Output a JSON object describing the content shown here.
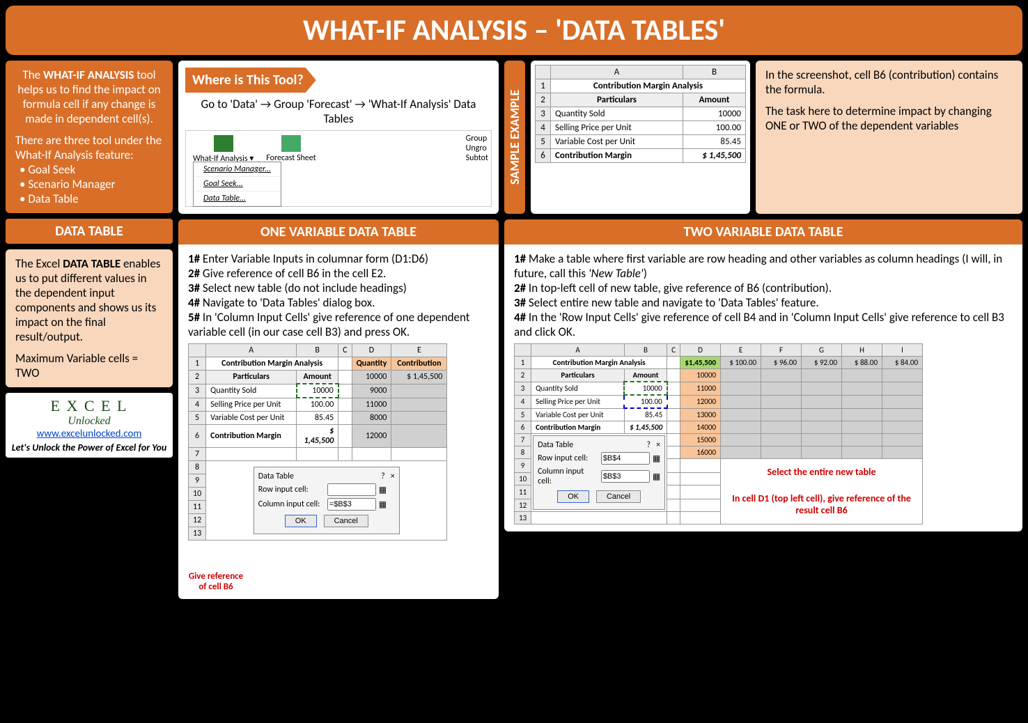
{
  "title": "WHAT-IF ANALYSIS – 'DATA TABLES'",
  "sidebar": {
    "intro_html": "The <b>WHAT-IF ANALYSIS</b> tool helps us to find the impact on formula cell if any change is made in dependent cell(s).",
    "three_tools_lead": "There are three tool under the What-If Analysis feature:",
    "tools": [
      "Goal Seek",
      "Scenario Manager",
      "Data Table"
    ],
    "datatable_header": "DATA TABLE",
    "datatable_body_html": "The Excel <b>DATA TABLE</b> enables us to put different values in the dependent input components and shows us its impact on the final result/output.",
    "max_var": "Maximum Variable cells = TWO",
    "logo_top": "E X C E L",
    "logo_sub": "Unlocked",
    "url": "www.excelunlocked.com",
    "tagline": "Let's Unlock the Power of Excel for You"
  },
  "where": {
    "label": "Where is This Tool?",
    "path": "Go to 'Data' → Group 'Forecast' → 'What-If Analysis' Data Tables",
    "ribbon_btn1": "What-If Analysis ▾",
    "ribbon_btn2": "Forecast Sheet",
    "ribbon_side": [
      "Group",
      "Ungro",
      "Subtot"
    ],
    "menu": [
      "Scenario Manager...",
      "Goal Seek...",
      "Data Table..."
    ]
  },
  "sample": {
    "tab": "SAMPLE EXAMPLE",
    "table_title": "Contribution Margin Analysis",
    "col_a": "A",
    "col_b": "B",
    "h_part": "Particulars",
    "h_amt": "Amount",
    "rows": [
      {
        "n": "3",
        "p": "Quantity Sold",
        "a": "10000"
      },
      {
        "n": "4",
        "p": "Selling Price per Unit",
        "a": "100.00"
      },
      {
        "n": "5",
        "p": "Variable Cost per Unit",
        "a": "85.45"
      },
      {
        "n": "6",
        "p": "Contribution Margin",
        "a": "$  1,45,500"
      }
    ],
    "explain1": "In the screenshot, cell B6 (contribution) contains the formula.",
    "explain2": "The task here to determine impact by changing ONE or TWO of the dependent variables"
  },
  "one": {
    "header": "ONE VARIABLE DATA TABLE",
    "steps": [
      "<b>1#</b> Enter Variable Inputs in columnar form (D1:D6)",
      "<b>2#</b> Give reference of cell B6 in the cell E2.",
      "<b>3#</b> Select new table (do not include headings)",
      "<b>4#</b> Navigate to 'Data Tables' dialog box.",
      "<b>5#</b> In 'Column Input Cells' give reference of one dependent variable cell (in our case cell B3) and press OK."
    ],
    "qty_hdr": "Quantity",
    "contrib_hdr": "Contribution",
    "qty_vals": [
      "10000",
      "9000",
      "11000",
      "8000",
      "12000"
    ],
    "e2_val": "$    1,45,500",
    "dialog_title": "Data Table",
    "row_lbl": "Row input cell:",
    "col_lbl": "Column input cell:",
    "col_val": "=$B$3",
    "ok": "OK",
    "cancel": "Cancel",
    "annot": "Give reference of cell B6"
  },
  "two": {
    "header": "TWO VARIABLE DATA TABLE",
    "steps": [
      "<b>1#</b> Make a table where first variable are row heading and other variables as column headings (I will, in future, call this <i>'New Table'</i>)",
      "<b>2#</b> In top-left cell of new table, give reference of B6 (contribution).",
      "<b>3#</b> Select entire new table and navigate to 'Data Tables' feature.",
      "<b>4#</b> In the 'Row Input Cells' give reference of cell B4 and in 'Column Input Cells' give reference to cell B3 and click OK."
    ],
    "d1": "$1,45,500",
    "col_prices": [
      "$  100.00",
      "$    96.00",
      "$    92.00",
      "$    88.00",
      "$    84.00"
    ],
    "row_qty": [
      "10000",
      "11000",
      "12000",
      "13000",
      "14000",
      "15000",
      "16000"
    ],
    "row_val": "$B$4",
    "col_val": "$B$3",
    "annot1": "Select the entire new table",
    "annot2": "In cell D1 (top left cell), give reference of the result cell B6"
  }
}
